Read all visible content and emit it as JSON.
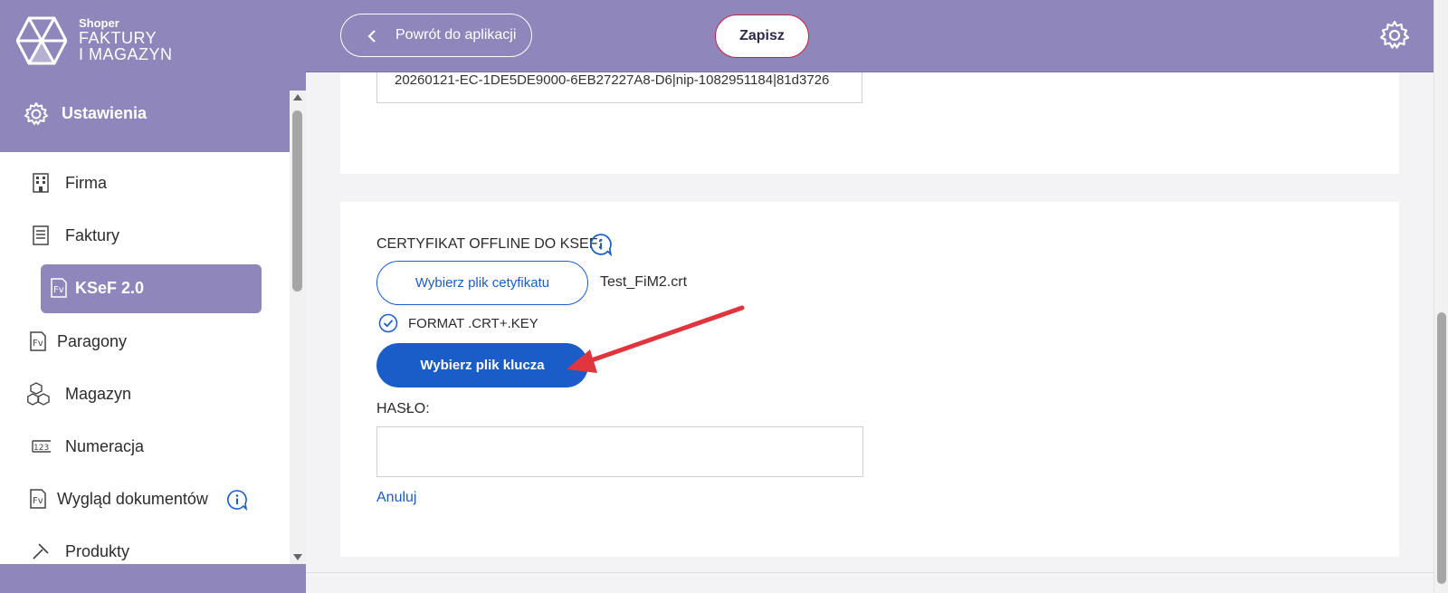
{
  "brand": {
    "small": "Shoper",
    "line1": "FAKTURY",
    "line2": "I MAGAZYN"
  },
  "sidebar": {
    "header": "Ustawienia",
    "items": [
      {
        "label": "Firma",
        "icon": "building-icon"
      },
      {
        "label": "Faktury",
        "icon": "document-icon"
      },
      {
        "label": "KSeF 2.0",
        "icon": "fv-icon",
        "active": true
      },
      {
        "label": "Paragony",
        "icon": "fv-icon"
      },
      {
        "label": "Magazyn",
        "icon": "boxes-icon"
      },
      {
        "label": "Numeracja",
        "icon": "numbers-icon"
      },
      {
        "label": "Wygląd dokumentów",
        "icon": "fv-icon",
        "info": true
      },
      {
        "label": "Produkty",
        "icon": "tools-icon"
      }
    ]
  },
  "topbar": {
    "back_label": "Powrót do aplikacji",
    "save_label": "Zapisz"
  },
  "token": {
    "value": "20260121-EC-1DE5DE9000-6EB27227A8-D6|nip-1082951184|81d3726"
  },
  "cert": {
    "label": "CERTYFIKAT OFFLINE DO KSEF:",
    "choose_cert_label": "Wybierz plik cetyfikatu",
    "cert_file": "Test_FiM2.crt",
    "format_label": "FORMAT .CRT+.KEY",
    "choose_key_label": "Wybierz plik klucza",
    "password_label": "HASŁO:",
    "password_value": "",
    "cancel_label": "Anuluj"
  },
  "colors": {
    "primary": "#8f87bb",
    "accent": "#1a5dc8",
    "save_border": "#c7223a",
    "arrow": "#e0353f"
  }
}
